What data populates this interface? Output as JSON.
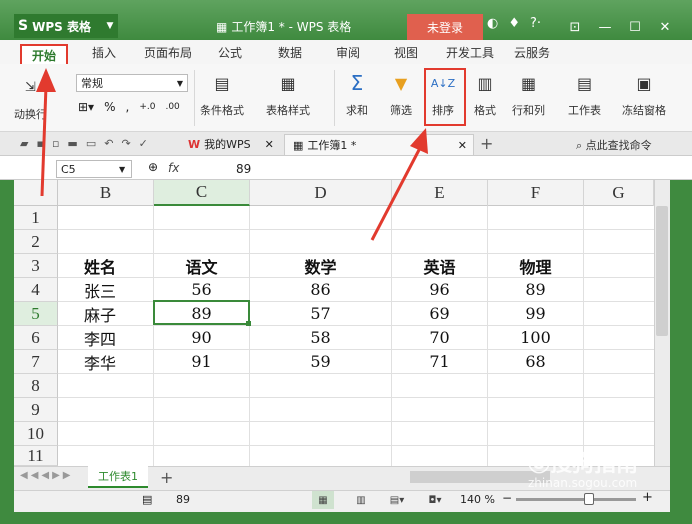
{
  "titlebar": {
    "app_name": "WPS 表格",
    "doc_title": "工作簿1 * - WPS 表格",
    "login": "未登录"
  },
  "menu": {
    "tabs": [
      "开始",
      "插入",
      "页面布局",
      "公式",
      "数据",
      "审阅",
      "视图",
      "开发工具",
      "云服务"
    ]
  },
  "ribbon": {
    "wrap_label": "动换行",
    "number_format": "常规",
    "percent": "%",
    "comma": ",",
    "cond_format": "条件格式",
    "table_style": "表格样式",
    "sum": "求和",
    "filter": "筛选",
    "sort": "排序",
    "format": "格式",
    "rowcol": "行和列",
    "worksheet": "工作表",
    "freeze": "冻结窗格"
  },
  "doctabs": {
    "wps_tab": "我的WPS",
    "book_tab": "工作簿1 *",
    "search": "点此查找命令"
  },
  "formula_bar": {
    "name_box": "C5",
    "fx": "fx",
    "value": "89"
  },
  "grid": {
    "columns": [
      "B",
      "C",
      "D",
      "E",
      "F",
      "G"
    ],
    "rows": [
      "1",
      "2",
      "3",
      "4",
      "5",
      "6",
      "7",
      "8",
      "9",
      "10",
      "11"
    ],
    "header": [
      "姓名",
      "语文",
      "数学",
      "英语",
      "物理"
    ],
    "data": [
      [
        "张三",
        "56",
        "86",
        "96",
        "89"
      ],
      [
        "麻子",
        "89",
        "57",
        "69",
        "99"
      ],
      [
        "李四",
        "90",
        "58",
        "70",
        "100"
      ],
      [
        "李华",
        "91",
        "59",
        "71",
        "68"
      ]
    ]
  },
  "sheets": {
    "active": "工作表1"
  },
  "status": {
    "value": "89",
    "zoom": "140 %"
  },
  "watermark": {
    "main": "搜狗指南",
    "sub": "zhinan.sogou.com"
  }
}
